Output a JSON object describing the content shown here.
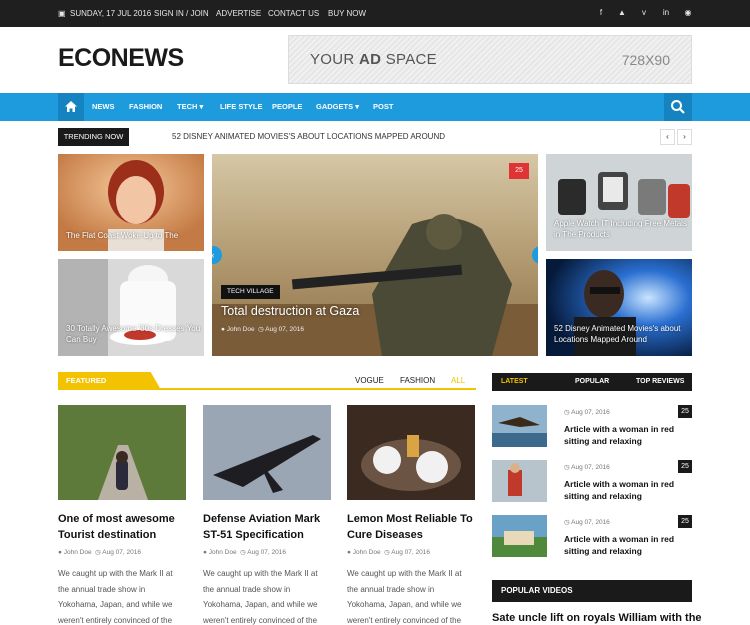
{
  "topbar": {
    "date": "SUNDAY, 17 JUL 2016",
    "links": [
      "SIGN IN / JOIN",
      "ADVERTISE",
      "CONTACT US",
      "BUY NOW"
    ],
    "social_icons": [
      "facebook-icon",
      "twitter-icon",
      "vimeo-icon",
      "linkedin-icon",
      "rss-icon"
    ]
  },
  "header": {
    "logo": "ECONEWS",
    "ad_text_prefix": "YOUR ",
    "ad_text_bold": "AD",
    "ad_text_suffix": " SPACE",
    "ad_size": "728X90"
  },
  "nav": {
    "items": [
      "NEWS",
      "FASHION",
      "TECH",
      "LIFE STYLE",
      "PEOPLE",
      "GADGETS",
      "POST"
    ],
    "accent": "#1e9bdc"
  },
  "trending": {
    "label": "TRENDING NOW",
    "headline": "52 DISNEY ANIMATED MOVIES'S ABOUT LOCATIONS MAPPED AROUND"
  },
  "slider": {
    "left_top_caption": "The Flat Coast Woke Up to The",
    "left_bottom_caption": "30 Totally Awesome '80s Dresses You Can Buy",
    "main": {
      "comment_count": "25",
      "category": "TECH VILLAGE",
      "title": "Total destruction at Gaza",
      "author": "John Doe",
      "date": "Aug 07, 2016"
    },
    "right_top_caption": "Apple Watch IT Including Free Metals in The Products",
    "right_bottom_caption": "52 Disney Animated Movies's about Locations Mapped Around"
  },
  "featured": {
    "label": "FEATURED",
    "tabs": [
      "VOGUE",
      "FASHION",
      "ALL"
    ],
    "accent": "#f3c200",
    "cards": [
      {
        "title": "One of most awesome Tourist destination",
        "author": "John Doe",
        "date": "Aug 07, 2016",
        "excerpt": "We caught up with the Mark II at the annual trade show in Yokohama, Japan, and while we weren't entirely convinced of the camera's practicality."
      },
      {
        "title": "Defense Aviation Mark ST-51 Specification",
        "author": "John Doe",
        "date": "Aug 07, 2016",
        "excerpt": "We caught up with the Mark II at the annual trade show in Yokohama, Japan, and while we weren't entirely convinced of the camera's practicality."
      },
      {
        "title": "Lemon Most Reliable To Cure Diseases",
        "author": "John Doe",
        "date": "Aug 07, 2016",
        "excerpt": "We caught up with the Mark II at the annual trade show in Yokohama, Japan, and while we weren't entirely convinced of the camera's practicality."
      }
    ]
  },
  "sidebar": {
    "tabs": [
      "LATEST",
      "POPULAR",
      "TOP REVIEWS"
    ],
    "items": [
      {
        "date": "Aug 07, 2016",
        "title": "Article with a woman in red sitting and relaxing",
        "count": "25"
      },
      {
        "date": "Aug 07, 2016",
        "title": "Article with a woman in red sitting and relaxing",
        "count": "25"
      },
      {
        "date": "Aug 07, 2016",
        "title": "Article with a woman in red sitting and relaxing",
        "count": "25"
      }
    ],
    "popular_videos_label": "POPULAR VIDEOS",
    "popular_video_title": "Sate uncle lift on royals William with the"
  }
}
